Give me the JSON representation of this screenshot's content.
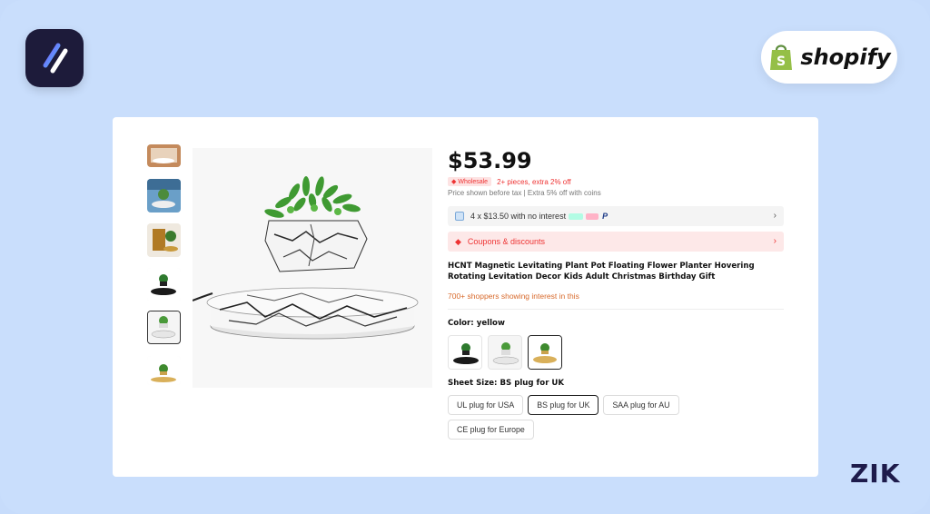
{
  "brand": {
    "app_logo_icon": "slash-stripes-icon",
    "shopify_text": "shopify",
    "zik_text": "ZIK"
  },
  "product": {
    "price": "$53.99",
    "wholesale_badge": "Wholesale",
    "wholesale_text": "2+ pieces, extra 2% off",
    "tax_note": "Price shown before tax",
    "coins_note": "Extra 5% off with coins",
    "installment_text": "4 x $13.50 with no interest",
    "coupons_text": "Coupons & discounts",
    "title": "HCNT Magnetic Levitating Plant Pot Floating Flower Planter Hovering Rotating Levitation Decor Kids Adult Christmas Birthday Gift",
    "interest_text": "700+ shoppers showing interest in this",
    "color_label": "Color: yellow",
    "size_label": "Sheet Size: BS plug for UK",
    "sizes": [
      "UL plug for USA",
      "BS plug for UK",
      "SAA plug for AU",
      "CE plug for Europe"
    ],
    "selected_size": "BS plug for UK"
  },
  "colors": {
    "background": "#c9defc",
    "accent_red": "#e33333",
    "interest_orange": "#d86a2c",
    "logo_bg": "#1d1b3a"
  }
}
